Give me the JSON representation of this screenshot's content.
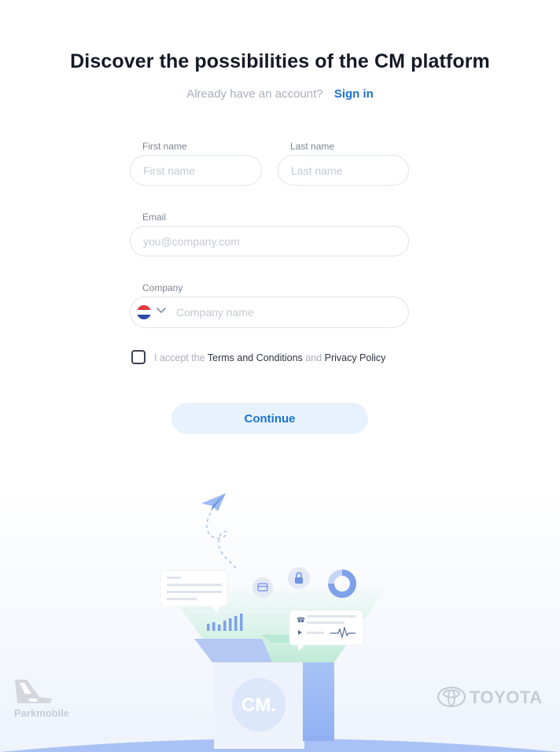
{
  "header": {
    "title": "Discover the possibilities of the CM platform",
    "account_prompt": "Already have an account?",
    "signin_label": "Sign in"
  },
  "form": {
    "first_name": {
      "label": "First name",
      "placeholder": "First name",
      "value": ""
    },
    "last_name": {
      "label": "Last name",
      "placeholder": "Last name",
      "value": ""
    },
    "email": {
      "label": "Email",
      "placeholder": "you@company.com",
      "value": ""
    },
    "company": {
      "label": "Company",
      "placeholder": "Company name",
      "value": "",
      "country_flag_icon": "netherlands-flag-icon"
    },
    "terms": {
      "checked": false,
      "prefix": "I accept the",
      "terms_link": "Terms and Conditions",
      "joiner": "and",
      "privacy_link": "Privacy Policy"
    },
    "continue_label": "Continue"
  },
  "illustration": {
    "center_logo": "CM.",
    "icons": [
      "paper-plane-icon",
      "chat-bubble-icon",
      "bar-chart-icon",
      "credit-card-icon",
      "lock-icon",
      "donut-chart-icon",
      "phone-icon",
      "play-icon",
      "waveform-icon"
    ]
  },
  "partners": {
    "left": "Parkmobile",
    "right": "TOYOTA"
  },
  "colors": {
    "accent": "#1a73d1",
    "button_bg": "#e8f2fd",
    "muted_text": "#a9b0bd"
  }
}
